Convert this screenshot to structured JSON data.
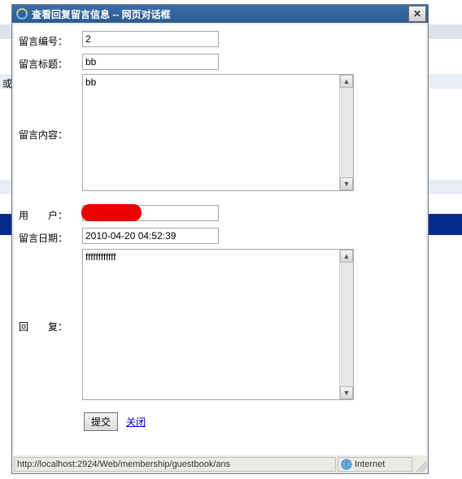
{
  "dialog": {
    "title": "查看回复留言信息 -- 网页对话框"
  },
  "labels": {
    "id": "留言编号：",
    "title": "留言标题：",
    "content": "留言内容：",
    "user": "用　　户：",
    "date": "留言日期：",
    "reply": "回　　复："
  },
  "values": {
    "id": "2",
    "title": "bb",
    "content": "bb",
    "user": "",
    "date": "2010-04-20 04:52:39",
    "reply": "ffffffffffff"
  },
  "buttons": {
    "submit": "提交",
    "close": "关闭"
  },
  "statusbar": {
    "url": "http://localhost:2924/Web/membership/guestbook/ans",
    "zone": "Internet"
  },
  "background": {
    "or_text": "或"
  }
}
